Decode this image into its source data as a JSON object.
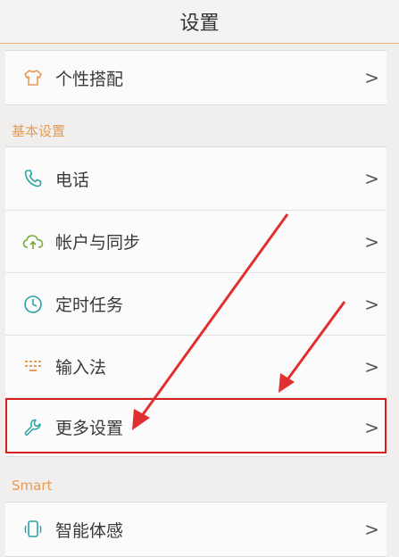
{
  "header": {
    "title": "设置"
  },
  "top_card": {
    "item": {
      "label": "个性搭配",
      "icon": "shirt-icon"
    }
  },
  "basic": {
    "header": "基本设置",
    "items": [
      {
        "label": "电话",
        "icon": "phone-icon"
      },
      {
        "label": "帐户与同步",
        "icon": "cloud-sync-icon"
      },
      {
        "label": "定时任务",
        "icon": "clock-icon"
      },
      {
        "label": "输入法",
        "icon": "keypad-icon"
      },
      {
        "label": "更多设置",
        "icon": "wrench-icon"
      }
    ]
  },
  "smart": {
    "header": "Smart",
    "items": [
      {
        "label": "智能体感",
        "icon": "phone-gesture-icon"
      }
    ]
  },
  "chevron": ">",
  "colors": {
    "accent": "#e59a55",
    "icon_teal": "#2ba3a7",
    "highlight": "#d92020",
    "annotation_arrow": "#e03030"
  }
}
